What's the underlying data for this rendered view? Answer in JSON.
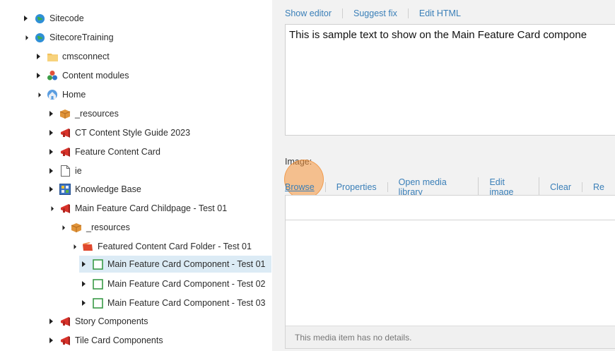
{
  "tree": {
    "items": [
      {
        "label": "Sitecode"
      },
      {
        "label": "SitecoreTraining"
      },
      {
        "label": "cmsconnect"
      },
      {
        "label": "Content modules"
      },
      {
        "label": "Home"
      },
      {
        "label": "_resources"
      },
      {
        "label": "CT Content Style Guide 2023"
      },
      {
        "label": "Feature Content Card"
      },
      {
        "label": "ie"
      },
      {
        "label": "Knowledge Base"
      },
      {
        "label": "Main Feature Card Childpage - Test 01"
      },
      {
        "label": "_resources"
      },
      {
        "label": "Featured Content Card Folder - Test 01"
      },
      {
        "label": "Main Feature Card Component - Test 01"
      },
      {
        "label": "Main Feature Card Component - Test 02"
      },
      {
        "label": "Main Feature Card Component - Test 03"
      },
      {
        "label": "Story Components"
      },
      {
        "label": "Tile Card Components"
      }
    ]
  },
  "editor": {
    "text_links": [
      "Show editor",
      "Suggest fix",
      "Edit HTML"
    ],
    "rich_text": "This is sample text to show on the Main Feature Card compone",
    "image_label": "Image:",
    "image_links": [
      "Browse",
      "Properties",
      "Open media library",
      "Edit image",
      "Clear",
      "Re"
    ],
    "media_details": "This media item has no details."
  },
  "colors": {
    "link": "#3a7fb8",
    "selected_row": "#dcebf5",
    "highlight": "#f5963c"
  }
}
